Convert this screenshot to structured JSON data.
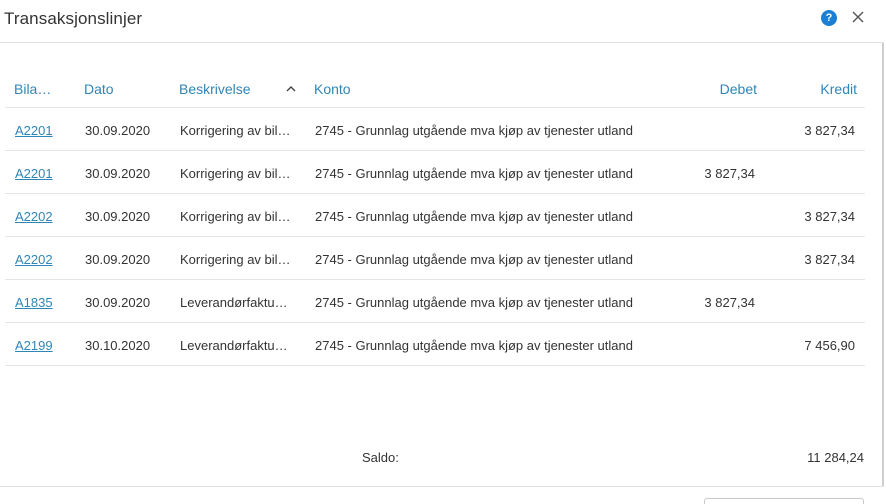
{
  "dialog": {
    "title": "Transaksjonslinjer",
    "help_glyph": "?",
    "close_glyph": "×"
  },
  "columns": {
    "bilag": "Bila…",
    "dato": "Dato",
    "beskrivelse": "Beskrivelse",
    "konto": "Konto",
    "debet": "Debet",
    "kredit": "Kredit"
  },
  "sort": {
    "column": "beskrivelse",
    "direction": "ascending"
  },
  "rows": [
    {
      "bilag": "A2201",
      "dato": "30.09.2020",
      "beskrivelse": "Korrigering av bil…",
      "konto": "2745 - Grunnlag utgående mva kjøp av tjenester utland",
      "debet": "",
      "kredit": "3 827,34"
    },
    {
      "bilag": "A2201",
      "dato": "30.09.2020",
      "beskrivelse": "Korrigering av bil…",
      "konto": "2745 - Grunnlag utgående mva kjøp av tjenester utland",
      "debet": "3 827,34",
      "kredit": ""
    },
    {
      "bilag": "A2202",
      "dato": "30.09.2020",
      "beskrivelse": "Korrigering av bil…",
      "konto": "2745 - Grunnlag utgående mva kjøp av tjenester utland",
      "debet": "",
      "kredit": "3 827,34"
    },
    {
      "bilag": "A2202",
      "dato": "30.09.2020",
      "beskrivelse": "Korrigering av bil…",
      "konto": "2745 - Grunnlag utgående mva kjøp av tjenester utland",
      "debet": "",
      "kredit": "3 827,34"
    },
    {
      "bilag": "A1835",
      "dato": "30.09.2020",
      "beskrivelse": "Leverandørfaktu…",
      "konto": "2745 - Grunnlag utgående mva kjøp av tjenester utland",
      "debet": "3 827,34",
      "kredit": ""
    },
    {
      "bilag": "A2199",
      "dato": "30.10.2020",
      "beskrivelse": "Leverandørfaktu…",
      "konto": "2745 - Grunnlag utgående mva kjøp av tjenester utland",
      "debet": "",
      "kredit": "7 456,90"
    }
  ],
  "summary": {
    "saldo_label": "Saldo:",
    "saldo_value": "11 284,24"
  },
  "colors": {
    "link": "#2f86b6",
    "help_badge": "#1b80d4",
    "text": "#333333",
    "border": "#e4e4e4"
  }
}
